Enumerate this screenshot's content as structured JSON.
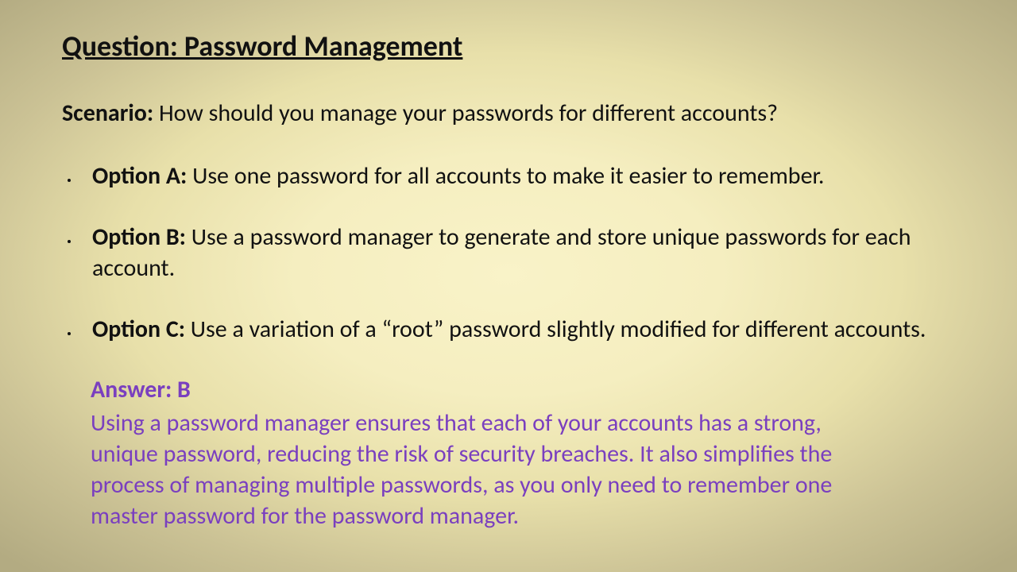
{
  "title": "Question: Password Management",
  "scenario": {
    "label": "Scenario:",
    "text": " How should you manage your passwords for different accounts?"
  },
  "options": [
    {
      "label": "Option A:",
      "text": " Use one password for all accounts to make it easier to remember."
    },
    {
      "label": "Option B:",
      "text": " Use a password manager to generate and store unique passwords for each account."
    },
    {
      "label": "Option C:",
      "text": " Use a variation of a “root” password slightly modified for different accounts."
    }
  ],
  "answer": {
    "heading": "Answer: B",
    "text": "Using a password manager ensures that each of your accounts has a strong, unique password, reducing the risk of security breaches. It also simplifies the process of managing multiple passwords, as you only need to remember one master password for the password manager."
  }
}
